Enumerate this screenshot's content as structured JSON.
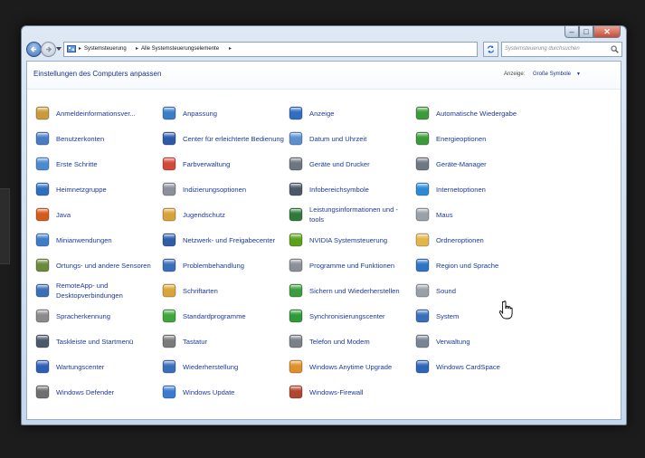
{
  "window": {
    "caption": {
      "minimize": "–",
      "maximize": "□",
      "close": "✕"
    },
    "breadcrumb": [
      "Systemsteuerung",
      "Alle Systemsteuerungselemente"
    ],
    "search": {
      "placeholder": "Systemsteuerung durchsuchen"
    }
  },
  "header": {
    "title": "Einstellungen des Computers anpassen",
    "view_label": "Anzeige:",
    "view_value": "Große Symbole",
    "view_dropdown": "▼"
  },
  "items": [
    {
      "label": "Anmeldeinformationsver...",
      "icon": "credential-manager-icon",
      "color": "#c89a3c"
    },
    {
      "label": "Benutzerkonten",
      "icon": "user-accounts-icon",
      "color": "#4a7bc4"
    },
    {
      "label": "Erste Schritte",
      "icon": "getting-started-icon",
      "color": "#4a8ad0"
    },
    {
      "label": "Heimnetzgruppe",
      "icon": "homegroup-icon",
      "color": "#2f6fc0"
    },
    {
      "label": "Java",
      "icon": "java-icon",
      "color": "#d25c1c"
    },
    {
      "label": "Minianwendungen",
      "icon": "gadgets-icon",
      "color": "#3f7cc8"
    },
    {
      "label": "Ortungs- und andere Sensoren",
      "icon": "sensors-icon",
      "color": "#6a8a3a"
    },
    {
      "label": "RemoteApp- und Desktopverbindungen",
      "icon": "remoteapp-icon",
      "color": "#3c6fb5"
    },
    {
      "label": "Spracherkennung",
      "icon": "microphone-icon",
      "color": "#8a8a8a"
    },
    {
      "label": "Taskleiste und Startmenü",
      "icon": "taskbar-icon",
      "color": "#4b5a6a"
    },
    {
      "label": "Wartungscenter",
      "icon": "action-center-flag-icon",
      "color": "#2f5fb5"
    },
    {
      "label": "Windows Defender",
      "icon": "windows-defender-icon",
      "color": "#6f6f6f"
    },
    {
      "label": "Anpassung",
      "icon": "personalization-icon",
      "color": "#3a7ec6"
    },
    {
      "label": "Center für erleichterte Bedienung",
      "icon": "ease-of-access-icon",
      "color": "#2d5aa8"
    },
    {
      "label": "Farbverwaltung",
      "icon": "color-management-icon",
      "color": "#d0493b"
    },
    {
      "label": "Indizierungsoptionen",
      "icon": "indexing-icon",
      "color": "#8a8f99"
    },
    {
      "label": "Jugendschutz",
      "icon": "parental-controls-icon",
      "color": "#d7a23a"
    },
    {
      "label": "Netzwerk- und Freigabecenter",
      "icon": "network-icon",
      "color": "#2e5fa6"
    },
    {
      "label": "Problembehandlung",
      "icon": "troubleshooting-icon",
      "color": "#3d6fb8"
    },
    {
      "label": "Schriftarten",
      "icon": "fonts-icon",
      "color": "#d9a53a"
    },
    {
      "label": "Standardprogramme",
      "icon": "default-programs-icon",
      "color": "#3fa53c"
    },
    {
      "label": "Tastatur",
      "icon": "keyboard-icon",
      "color": "#7a7a7a"
    },
    {
      "label": "Wiederherstellung",
      "icon": "recovery-icon",
      "color": "#3b6fb8"
    },
    {
      "label": "Windows Update",
      "icon": "windows-update-icon",
      "color": "#3a7bd0"
    },
    {
      "label": "Anzeige",
      "icon": "display-icon",
      "color": "#2f6ec0"
    },
    {
      "label": "Datum und Uhrzeit",
      "icon": "date-time-icon",
      "color": "#5d8fd0"
    },
    {
      "label": "Geräte und Drucker",
      "icon": "printer-icon",
      "color": "#6d7580"
    },
    {
      "label": "Infobereichsymbole",
      "icon": "notification-icons-icon",
      "color": "#4a5868"
    },
    {
      "label": "Leistungsinformationen und -tools",
      "icon": "performance-icon",
      "color": "#2f7a3a"
    },
    {
      "label": "NVIDIA Systemsteuerung",
      "icon": "nvidia-icon",
      "color": "#5ca11a"
    },
    {
      "label": "Programme und Funktionen",
      "icon": "programs-features-icon",
      "color": "#8a8f99"
    },
    {
      "label": "Sichern und Wiederherstellen",
      "icon": "backup-icon",
      "color": "#3b9d3b"
    },
    {
      "label": "Synchronisierungscenter",
      "icon": "sync-center-icon",
      "color": "#2f9a3a"
    },
    {
      "label": "Telefon und Modem",
      "icon": "phone-modem-icon",
      "color": "#7a7f88"
    },
    {
      "label": "Windows Anytime Upgrade",
      "icon": "anytime-upgrade-icon",
      "color": "#e0902a"
    },
    {
      "label": "Windows-Firewall",
      "icon": "firewall-icon",
      "color": "#b2452e"
    },
    {
      "label": "Automatische Wiedergabe",
      "icon": "autoplay-icon",
      "color": "#3c9a3c"
    },
    {
      "label": "Energieoptionen",
      "icon": "power-options-icon",
      "color": "#3b9b3b"
    },
    {
      "label": "Geräte-Manager",
      "icon": "device-manager-icon",
      "color": "#6f7782"
    },
    {
      "label": "Internetoptionen",
      "icon": "internet-options-icon",
      "color": "#2f8ad6"
    },
    {
      "label": "Maus",
      "icon": "mouse-icon",
      "color": "#9aa0a8"
    },
    {
      "label": "Ordneroptionen",
      "icon": "folder-options-icon",
      "color": "#e2b64a"
    },
    {
      "label": "Region und Sprache",
      "icon": "region-language-icon",
      "color": "#2f73c4"
    },
    {
      "label": "Sound",
      "icon": "sound-icon",
      "color": "#9aa0a8"
    },
    {
      "label": "System",
      "icon": "system-icon",
      "color": "#3a6fb8"
    },
    {
      "label": "Verwaltung",
      "icon": "administrative-tools-icon",
      "color": "#7a8594"
    },
    {
      "label": "Windows CardSpace",
      "icon": "cardspace-icon",
      "color": "#2e65b8"
    }
  ]
}
